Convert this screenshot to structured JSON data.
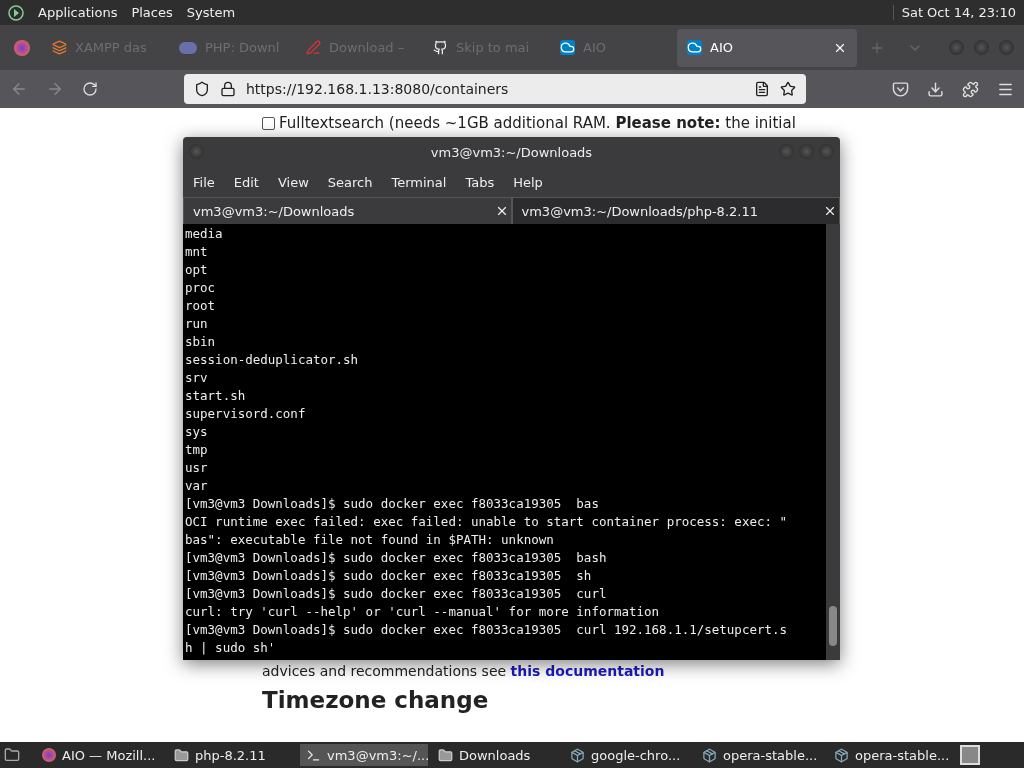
{
  "top_panel": {
    "menus": [
      "Applications",
      "Places",
      "System"
    ],
    "clock": "Sat Oct 14, 23:10"
  },
  "browser_tabs": [
    {
      "label": "XAMPP das",
      "selected": false
    },
    {
      "label": "PHP: Downl",
      "selected": false
    },
    {
      "label": "Download –",
      "selected": false
    },
    {
      "label": "Skip to mai",
      "selected": false
    },
    {
      "label": "AIO",
      "selected": false
    },
    {
      "label": "AIO",
      "selected": true
    }
  ],
  "address_bar": {
    "url": "https://192.168.1.13:8080/containers"
  },
  "page": {
    "checkbox_text": "Fulltextsearch (needs ~1GB additional RAM. **Please note:** the initial",
    "checked": false,
    "advice_text": "advices and recommendations see",
    "advice_link": "this documentation",
    "heading": "Timezone change"
  },
  "terminal": {
    "title": "vm3@vm3:~/Downloads",
    "menus": [
      "File",
      "Edit",
      "View",
      "Search",
      "Terminal",
      "Tabs",
      "Help"
    ],
    "tabs": [
      {
        "label": "vm3@vm3:~/Downloads",
        "selected": true
      },
      {
        "label": "vm3@vm3:~/Downloads/php-8.2.11",
        "selected": false
      }
    ],
    "lines": [
      "media",
      "mnt",
      "opt",
      "proc",
      "root",
      "run",
      "sbin",
      "session-deduplicator.sh",
      "srv",
      "start.sh",
      "supervisord.conf",
      "sys",
      "tmp",
      "usr",
      "var",
      "[vm3@vm3 Downloads]$ sudo docker exec f8033ca19305  bas",
      "OCI runtime exec failed: exec failed: unable to start container process: exec: \"",
      "bas\": executable file not found in $PATH: unknown",
      "[vm3@vm3 Downloads]$ sudo docker exec f8033ca19305  bash",
      "[vm3@vm3 Downloads]$ sudo docker exec f8033ca19305  sh",
      "[vm3@vm3 Downloads]$ sudo docker exec f8033ca19305  curl",
      "curl: try 'curl --help' or 'curl --manual' for more information",
      "[vm3@vm3 Downloads]$ sudo docker exec f8033ca19305  curl 192.168.1.1/setupcert.s",
      "h | sudo sh'"
    ]
  },
  "taskbar": [
    {
      "label": "AIO — Mozill...",
      "selected": false
    },
    {
      "label": "php-8.2.11",
      "selected": false
    },
    {
      "label": "vm3@vm3:~/...",
      "selected": true
    },
    {
      "label": "Downloads",
      "selected": false
    },
    {
      "label": "google-chro...",
      "selected": false
    },
    {
      "label": "opera-stable...",
      "selected": false
    },
    {
      "label": "opera-stable...",
      "selected": false
    }
  ]
}
